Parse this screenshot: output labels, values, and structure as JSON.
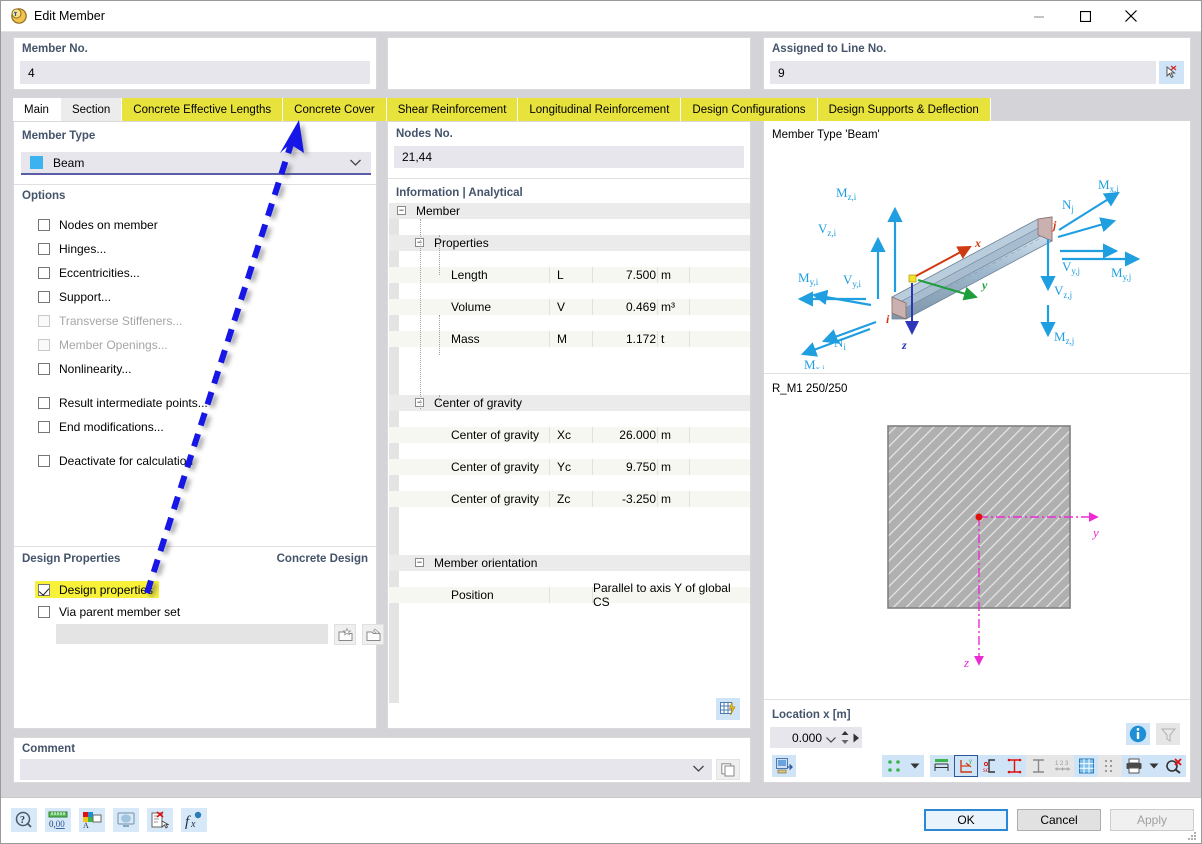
{
  "window": {
    "title": "Edit Member",
    "icon": "member-icon",
    "minimize": "minimize-icon",
    "maximize": "maximize-icon",
    "close": "close-icon"
  },
  "top_fields": {
    "member_no_label": "Member No.",
    "member_no_value": "4",
    "assigned_line_label": "Assigned to Line No.",
    "assigned_line_value": "9",
    "pick_icon": "select-line-icon"
  },
  "tabs": [
    {
      "label": "Main",
      "state": "active"
    },
    {
      "label": "Section",
      "state": "normal"
    },
    {
      "label": "Concrete Effective Lengths",
      "state": "highlighted"
    },
    {
      "label": "Concrete Cover",
      "state": "highlighted"
    },
    {
      "label": "Shear Reinforcement",
      "state": "highlighted"
    },
    {
      "label": "Longitudinal Reinforcement",
      "state": "highlighted"
    },
    {
      "label": "Design Configurations",
      "state": "highlighted"
    },
    {
      "label": "Design Supports & Deflection",
      "state": "highlighted"
    }
  ],
  "left": {
    "member_type_label": "Member Type",
    "member_type_value": "Beam",
    "member_type_color": "#3cb3f0",
    "options_label": "Options",
    "options": [
      {
        "label": "Nodes on member",
        "checked": false,
        "disabled": false
      },
      {
        "label": "Hinges...",
        "checked": false,
        "disabled": false
      },
      {
        "label": "Eccentricities...",
        "checked": false,
        "disabled": false
      },
      {
        "label": "Support...",
        "checked": false,
        "disabled": false
      },
      {
        "label": "Transverse Stiffeners...",
        "checked": false,
        "disabled": true
      },
      {
        "label": "Member Openings...",
        "checked": false,
        "disabled": true
      },
      {
        "label": "Nonlinearity...",
        "checked": false,
        "disabled": false
      },
      {
        "label": "Result intermediate points...",
        "checked": false,
        "disabled": false
      },
      {
        "label": "End modifications...",
        "checked": false,
        "disabled": false
      },
      {
        "label": "Deactivate for calculation",
        "checked": false,
        "disabled": false
      }
    ],
    "design_properties_label": "Design Properties",
    "design_properties_right": "Concrete Design",
    "design_properties_checkbox": "Design properties",
    "design_properties_checked": true,
    "via_parent_checkbox": "Via parent member set",
    "via_parent_checked": false,
    "parent_set_value": "",
    "new_set_icon": "new-member-set-icon",
    "edit_set_icon": "edit-member-set-icon",
    "highlight_color": "#f7f13a"
  },
  "middle": {
    "nodes_label": "Nodes No.",
    "nodes_value": "21,44",
    "info_header": "Information | Analytical",
    "tree": {
      "root": "Member",
      "groups": [
        {
          "name": "Properties",
          "rows": [
            {
              "name": "Length",
              "symbol": "L",
              "value": "7.500",
              "unit": "m"
            },
            {
              "name": "Volume",
              "symbol": "V",
              "value": "0.469",
              "unit": "m³"
            },
            {
              "name": "Mass",
              "symbol": "M",
              "value": "1.172",
              "unit": "t"
            }
          ]
        },
        {
          "name": "Center of gravity",
          "rows": [
            {
              "name": "Center of gravity",
              "symbol": "Xc",
              "value": "26.000",
              "unit": "m"
            },
            {
              "name": "Center of gravity",
              "symbol": "Yc",
              "value": "9.750",
              "unit": "m"
            },
            {
              "name": "Center of gravity",
              "symbol": "Zc",
              "value": "-3.250",
              "unit": "m"
            }
          ]
        },
        {
          "name": "Member orientation",
          "rows": [
            {
              "name": "Position",
              "symbol": "",
              "value": "Parallel to axis Y of global CS",
              "unit": "",
              "wide": true
            }
          ]
        }
      ]
    },
    "bottom_button_icon": "table-lightning-icon"
  },
  "right": {
    "member_type_caption": "Member Type 'Beam'",
    "beam_diagram": {
      "node_i": "i",
      "node_j": "j",
      "local_axes": [
        "x",
        "y",
        "z"
      ],
      "labels_i": [
        "M_z,i",
        "V_z,i",
        "M_y,i",
        "V_y,i",
        "N_i",
        "M_x,i"
      ],
      "labels_j": [
        "M_x,j",
        "N_j",
        "V_y,j",
        "M_y,j",
        "V_z,j",
        "M_z,j"
      ]
    },
    "section_caption": "R_M1 250/250",
    "section_axes": [
      "y",
      "z"
    ],
    "location_label": "Location x [m]",
    "location_value": "0.000",
    "info_button_icon": "info-icon",
    "filter_button_icon": "filter-icon",
    "toolbar": [
      {
        "icon": "export-image-icon",
        "style": "blue",
        "name": "export-view-button"
      },
      {
        "icon": "points-icon",
        "style": "blue",
        "name": "show-points-button"
      },
      {
        "icon": "dropdown-arrow-icon",
        "style": "blue",
        "name": "points-dropdown-button"
      },
      {
        "icon": "dimensions-icon",
        "style": "blue",
        "name": "show-dimensions-button"
      },
      {
        "icon": "axes-icon",
        "style": "selected",
        "name": "show-axes-button"
      },
      {
        "icon": "shear-center-icon",
        "style": "blue",
        "name": "show-shear-center-button"
      },
      {
        "icon": "stress-points-icon",
        "style": "blue",
        "name": "show-stress-points-button"
      },
      {
        "icon": "parts-icon",
        "style": "grey",
        "name": "show-parts-button"
      },
      {
        "icon": "numbering-icon",
        "style": "grey",
        "name": "show-numbering-button"
      },
      {
        "icon": "grid-icon",
        "style": "blue",
        "name": "show-grid-button"
      },
      {
        "icon": "mesh-icon",
        "style": "grey",
        "name": "show-mesh-button"
      },
      {
        "icon": "print-icon",
        "style": "blue",
        "name": "print-button"
      },
      {
        "icon": "dropdown-arrow-icon",
        "style": "blue",
        "name": "print-dropdown-button"
      },
      {
        "icon": "reset-zoom-icon",
        "style": "blue",
        "name": "reset-view-button"
      }
    ]
  },
  "comment": {
    "label": "Comment",
    "value": "",
    "copy_icon": "copy-icon"
  },
  "footer": {
    "tools": [
      {
        "icon": "help-icon",
        "name": "help-button"
      },
      {
        "icon": "units-icon",
        "name": "units-button"
      },
      {
        "icon": "display-props-icon",
        "name": "display-properties-button"
      },
      {
        "icon": "render-icon",
        "name": "render-button"
      },
      {
        "icon": "delete-doc-icon",
        "name": "delete-button"
      },
      {
        "icon": "formula-icon",
        "name": "formula-button"
      }
    ],
    "ok": "OK",
    "cancel": "Cancel",
    "apply": "Apply"
  },
  "annotation": {
    "type": "arrow",
    "color": "#1414e6",
    "from": "design-properties-checkbox",
    "to": "concrete-effective-lengths-tab"
  }
}
